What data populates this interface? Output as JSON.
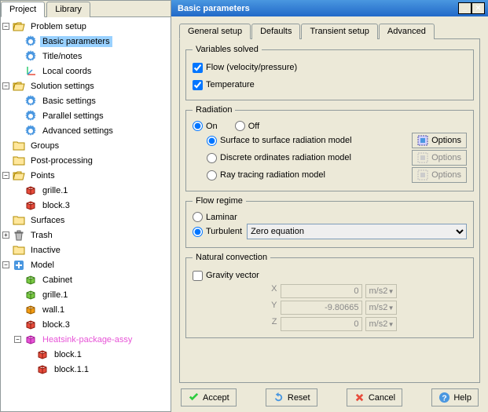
{
  "leftTabs": {
    "project": "Project",
    "library": "Library"
  },
  "tree": {
    "problemSetup": "Problem setup",
    "basicParameters": "Basic parameters",
    "titleNotes": "Title/notes",
    "localCoords": "Local coords",
    "solutionSettings": "Solution settings",
    "basicSettings": "Basic settings",
    "parallelSettings": "Parallel settings",
    "advancedSettings": "Advanced settings",
    "groups": "Groups",
    "postProcessing": "Post-processing",
    "points": "Points",
    "grille1": "grille.1",
    "block3": "block.3",
    "surfaces": "Surfaces",
    "trash": "Trash",
    "inactive": "Inactive",
    "model": "Model",
    "cabinet": "Cabinet",
    "grille1b": "grille.1",
    "wall1": "wall.1",
    "block3b": "block.3",
    "heatsink": "Heatsink-package-assy",
    "block1": "block.1",
    "block11": "block.1.1"
  },
  "dialog": {
    "title": "Basic parameters",
    "tabs": {
      "general": "General setup",
      "defaults": "Defaults",
      "transient": "Transient setup",
      "advanced": "Advanced"
    },
    "vars": {
      "legend": "Variables solved",
      "flow": "Flow (velocity/pressure)",
      "temp": "Temperature"
    },
    "radiation": {
      "legend": "Radiation",
      "on": "On",
      "off": "Off",
      "surface": "Surface to surface radiation model",
      "discrete": "Discrete ordinates radiation model",
      "ray": "Ray tracing radiation model",
      "options": "Options"
    },
    "flowRegime": {
      "legend": "Flow regime",
      "laminar": "Laminar",
      "turbulent": "Turbulent",
      "option": "Zero equation"
    },
    "natural": {
      "legend": "Natural convection",
      "gravity": "Gravity vector",
      "xLabel": "X",
      "yLabel": "Y",
      "zLabel": "Z",
      "xVal": "0",
      "yVal": "-9.80665",
      "zVal": "0",
      "unit": "m/s2"
    },
    "buttons": {
      "accept": "Accept",
      "reset": "Reset",
      "cancel": "Cancel",
      "help": "Help"
    }
  }
}
